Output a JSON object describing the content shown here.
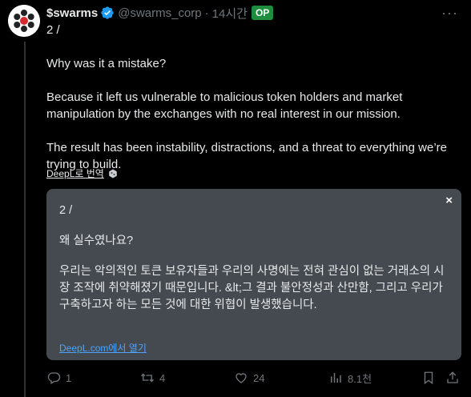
{
  "post": {
    "display_name": "$swarms",
    "handle": "@swarms_corp",
    "separator": "·",
    "time": "14시간",
    "op_badge": "OP",
    "lines": [
      "2 /",
      "Why was it a mistake?",
      "Because it left us vulnerable to malicious token holders and market manipulation by the exchanges with no real interest in our mission.",
      "The result has been instability, distractions, and a threat to everything we’re trying to build."
    ],
    "translate_link": "DeepL로 번역"
  },
  "translation": {
    "close": "×",
    "lines": [
      "2 /",
      "왜 실수였나요?",
      "우리는 악의적인 토큰 보유자들과 우리의 사명에는 전혀 관심이 없는 거래소의 시장 조작에 취약해졌기 때문입니다. &lt;그 결과 불안정성과 산만함, 그리고 우리가 구축하고자 하는 모든 것에 대한 위협이 발생했습니다."
    ],
    "open_link": "DeepL.com에서 열기"
  },
  "actions": {
    "replies": "1",
    "reposts": "4",
    "likes": "24",
    "views": "8.1천"
  },
  "colors": {
    "background": "#000000",
    "text": "#e7e9ea",
    "muted": "#71767b",
    "verified": "#1d9bf0",
    "op_badge": "#1e8e3e",
    "card_bg": "#444a50",
    "link": "#4da3ff"
  },
  "icons": [
    "verified-icon",
    "more-icon",
    "deepl-icon",
    "close-icon",
    "reply-icon",
    "repost-icon",
    "like-icon",
    "views-icon",
    "bookmark-icon",
    "share-icon"
  ]
}
